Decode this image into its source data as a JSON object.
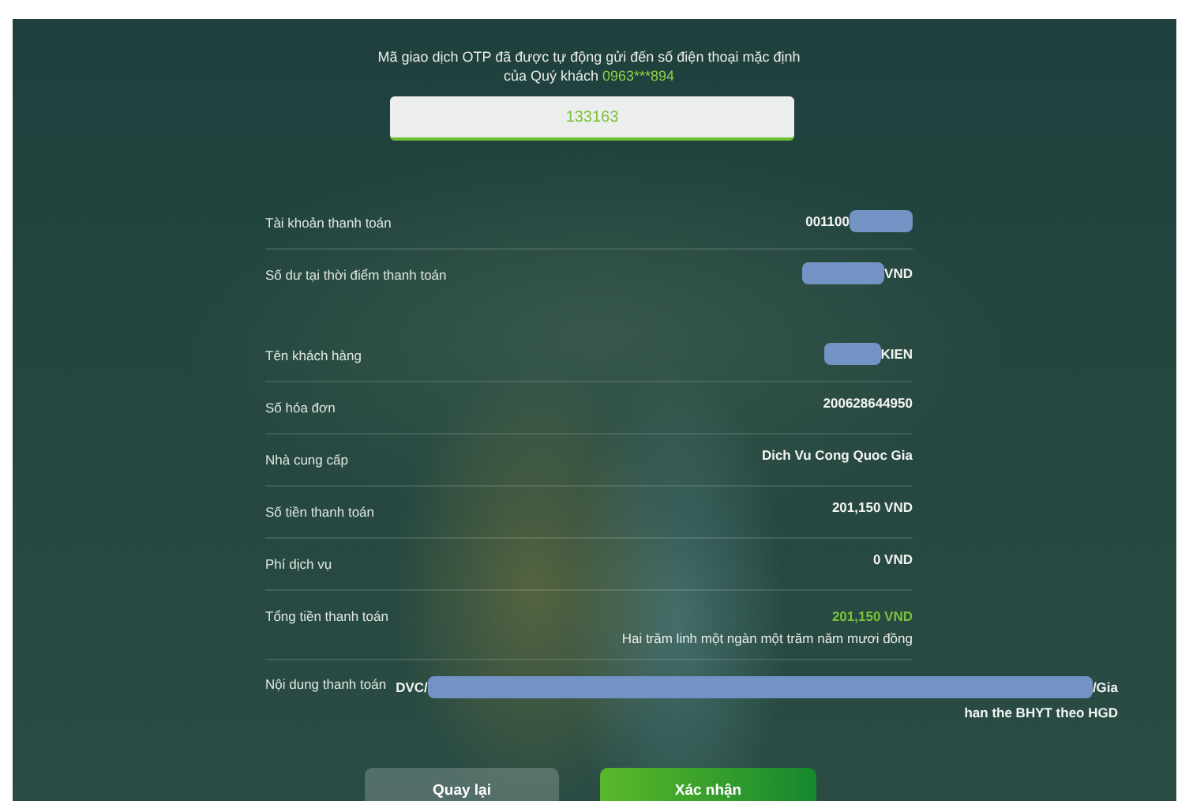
{
  "otp_notice": {
    "text": "Mã giao dịch OTP đã được tự động gửi đến số điện thoại mặc định của Quý khách",
    "phone": "0963***894"
  },
  "otp_field": {
    "value": "133163"
  },
  "rows": [
    {
      "kind": "plain",
      "label": "Tài khoản thanh toán",
      "value": "001100",
      "masked_before": false,
      "masked_after": true,
      "separator": true
    },
    {
      "kind": "plain",
      "label": "Số dư tại thời điểm thanh toán",
      "value": "VND",
      "masked_before": true,
      "masked_after": false,
      "separator": false
    },
    {
      "kind": "plain",
      "label": "Tên khách hàng",
      "value": "KIEN",
      "masked_before": true,
      "masked_after": false,
      "separator": true
    },
    {
      "kind": "plain",
      "label": "Số hóa đơn",
      "value": "200628644950",
      "masked_before": false,
      "masked_after": false,
      "separator": true
    },
    {
      "kind": "plain",
      "label": "Nhà cung cấp",
      "value": "Dich Vu Cong Quoc Gia",
      "masked_before": false,
      "masked_after": false,
      "separator": true
    },
    {
      "kind": "plain",
      "label": "Số tiền thanh toán",
      "value": "201,150 VND",
      "masked_before": false,
      "masked_after": false,
      "separator": true
    },
    {
      "kind": "plain",
      "label": "Phí dịch vụ",
      "value": "0 VND",
      "masked_before": false,
      "masked_after": false,
      "separator": true
    },
    {
      "kind": "total",
      "label": "Tổng tiền thanh toán",
      "value": "201,150 VND",
      "words": "Hai trăm linh một ngàn một trăm năm mươi đồng",
      "separator": true
    },
    {
      "kind": "content",
      "label": "Nội dung thanh toán",
      "value": "DVC/",
      "value_end": "/Gia",
      "value_line2": "han the BHYT theo HGD",
      "masked_middle": true
    }
  ],
  "buttons": [
    {
      "label": "Quay lại",
      "kind": "secondary"
    },
    {
      "label": "Xác nhận",
      "kind": "primary"
    }
  ]
}
